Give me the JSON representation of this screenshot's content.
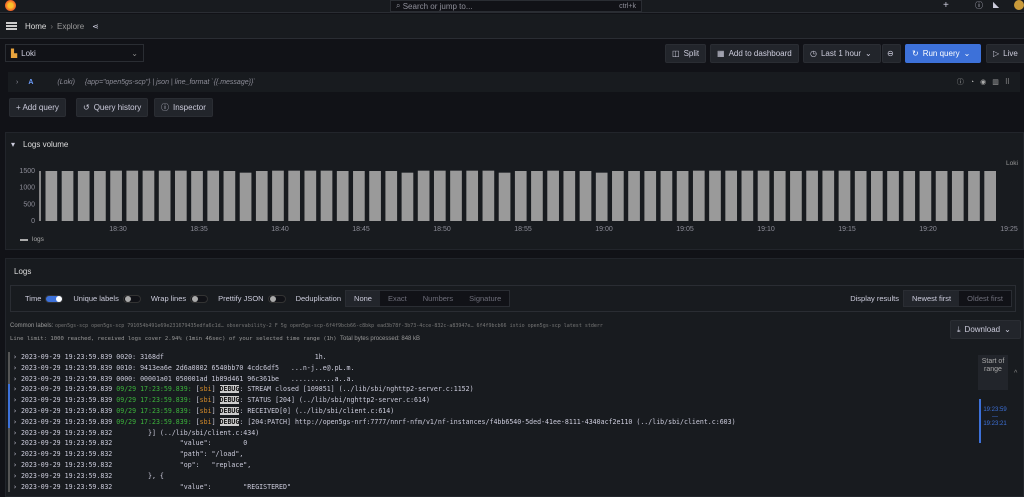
{
  "topbar": {
    "search_placeholder": "Search or jump to...",
    "shortcut": "ctrl+k",
    "plus": "+"
  },
  "breadcrumb": {
    "home": "Home",
    "sep": "›",
    "current": "Explore"
  },
  "toolbar": {
    "datasource": "Loki",
    "split": "Split",
    "add_to_dashboard": "Add to dashboard",
    "time_range": "Last 1 hour",
    "run_query": "Run query",
    "live": "Live"
  },
  "query": {
    "expand": "›",
    "ref": "A",
    "datasource": "(Loki)",
    "expr": "{app=\"open5gs-scp\"} | json | line_format `{{.message}}`"
  },
  "query_actions": {
    "add_query": "+ Add query",
    "query_history": "Query history",
    "inspector": "Inspector"
  },
  "logs_volume": {
    "title": "Logs volume",
    "collapse": "▾",
    "series_label": "Loki",
    "legend": "logs"
  },
  "chart_data": {
    "type": "bar",
    "title": "Logs volume",
    "ylim": [
      0,
      1700
    ],
    "yticks": [
      0,
      500,
      1000,
      1500
    ],
    "xticks": [
      "18:30",
      "18:35",
      "18:40",
      "18:45",
      "18:50",
      "18:55",
      "19:00",
      "19:05",
      "19:10",
      "19:15",
      "19:20",
      "19:25"
    ],
    "series": [
      {
        "name": "logs",
        "values": [
          1500,
          1500,
          1500,
          1500,
          1510,
          1510,
          1510,
          1510,
          1510,
          1500,
          1510,
          1500,
          1450,
          1500,
          1510,
          1510,
          1510,
          1510,
          1500,
          1500,
          1500,
          1500,
          1450,
          1510,
          1510,
          1510,
          1510,
          1510,
          1450,
          1500,
          1500,
          1510,
          1500,
          1500,
          1450,
          1500,
          1500,
          1500,
          1500,
          1500,
          1510,
          1510,
          1510,
          1510,
          1510,
          1500,
          1500,
          1510,
          1510,
          1510,
          1500,
          1500,
          1500,
          1500,
          1500,
          1500,
          1500,
          1500,
          1500
        ]
      }
    ]
  },
  "logs": {
    "title": "Logs",
    "options": {
      "time": "Time",
      "unique_labels": "Unique labels",
      "wrap_lines": "Wrap lines",
      "prettify_json": "Prettify JSON",
      "deduplication": "Deduplication",
      "dedup_modes": [
        "None",
        "Exact",
        "Numbers",
        "Signature"
      ],
      "display_results": "Display results",
      "newest_first": "Newest first",
      "oldest_first": "Oldest first"
    },
    "common_labels_label": "Common labels:",
    "common_labels": "open5gs-scp open5gs-scp 791054b491e69e231679435edfa6c1d… observability-2 F 5g open5gs-scp-6f4f9bcb66-c8bkp ead3b78f-3b73-4cce-832c-a83947e… 6f4f9bcb66 istio open5gs-scp latest stderr",
    "line_limit": "Line limit: 1000 reached, received logs cover 2.94% (1min 46sec) of your selected time range (1h)",
    "bytes": "Total bytes processed: 848 kB",
    "download": "Download",
    "range": {
      "start": "Start of range",
      "from": "19:23:59",
      "dash": "—",
      "to": "19:23:21"
    },
    "lines": [
      {
        "ts": "2023-09-29 19:23:59.839",
        "msg": "0020: 3168df                                      1h."
      },
      {
        "ts": "2023-09-29 19:23:59.839",
        "msg": "0010: 9413ea6e 2d6a0802 6540bb70 4cdc6df5   ...n-j..e@.pL.m."
      },
      {
        "ts": "2023-09-29 19:23:59.839",
        "msg": "0000: 00001a01 050001ad 1b89d461 96c361be   ...........a..a."
      },
      {
        "ts": "2023-09-29 19:23:59.839",
        "t2": "09/29 17:23:59.839:",
        "mod": "sbi",
        "lvl": "DEBUG",
        "msg": ": STREAM closed [109851] (../lib/sbi/nghttp2-server.c:1152)"
      },
      {
        "ts": "2023-09-29 19:23:59.839",
        "t2": "09/29 17:23:59.839:",
        "mod": "sbi",
        "lvl": "DEBUG",
        "msg": ": STATUS [204] (../lib/sbi/nghttp2-server.c:614)"
      },
      {
        "ts": "2023-09-29 19:23:59.839",
        "t2": "09/29 17:23:59.839:",
        "mod": "sbi",
        "lvl": "DEBUG",
        "msg": ": RECEIVED[0] (../lib/sbi/client.c:614)"
      },
      {
        "ts": "2023-09-29 19:23:59.839",
        "t2": "09/29 17:23:59.839:",
        "mod": "sbi",
        "lvl": "DEBUG",
        "msg": ": [204:PATCH] http://open5gs-nrf:7777/nnrf-nfm/v1/nf-instances/f4bb6540-5ded-41ee-8111-4340acf2e110 (../lib/sbi/client.c:603)"
      },
      {
        "ts": "2023-09-29 19:23:59.832",
        "msg": "        }] (../lib/sbi/client.c:434)"
      },
      {
        "ts": "2023-09-29 19:23:59.832",
        "msg": "                \"value\":        0"
      },
      {
        "ts": "2023-09-29 19:23:59.832",
        "msg": "                \"path\": \"/load\","
      },
      {
        "ts": "2023-09-29 19:23:59.832",
        "msg": "                \"op\":   \"replace\","
      },
      {
        "ts": "2023-09-29 19:23:59.832",
        "msg": "        }, {"
      },
      {
        "ts": "2023-09-29 19:23:59.832",
        "msg": "                \"value\":        \"REGISTERED\""
      }
    ]
  }
}
